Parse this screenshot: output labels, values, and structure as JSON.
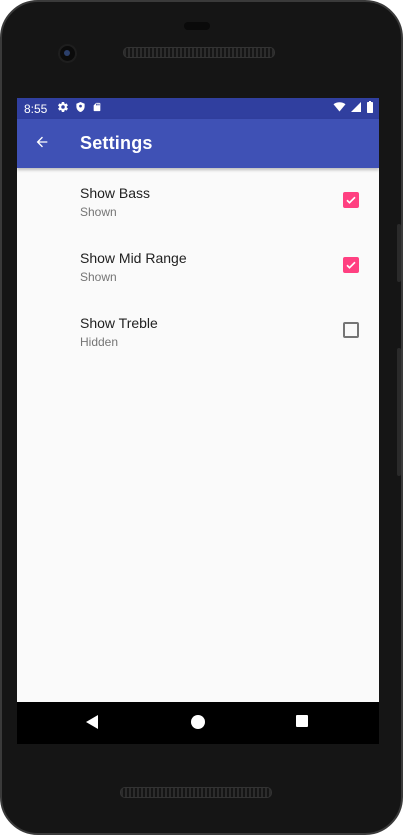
{
  "status_bar": {
    "time": "8:55",
    "left_icons": [
      "settings-icon",
      "shield-icon",
      "sd-card-icon"
    ],
    "right_icons": [
      "wifi-icon",
      "signal-icon",
      "battery-icon"
    ],
    "color": "#303f9f"
  },
  "app_bar": {
    "title": "Settings",
    "back_icon": "arrow-back-icon",
    "color": "#3f51b5"
  },
  "preferences": [
    {
      "title": "Show Bass",
      "summary": "Shown",
      "checked": true
    },
    {
      "title": "Show Mid Range",
      "summary": "Shown",
      "checked": true
    },
    {
      "title": "Show Treble",
      "summary": "Hidden",
      "checked": false
    }
  ],
  "colors": {
    "accent": "#ff4081",
    "screen_background": "#fafafa",
    "primary_text": "#212121",
    "secondary_text": "#757575"
  },
  "navigation_bar": {
    "buttons": [
      "nav-back-icon",
      "nav-home-icon",
      "nav-recents-icon"
    ]
  }
}
